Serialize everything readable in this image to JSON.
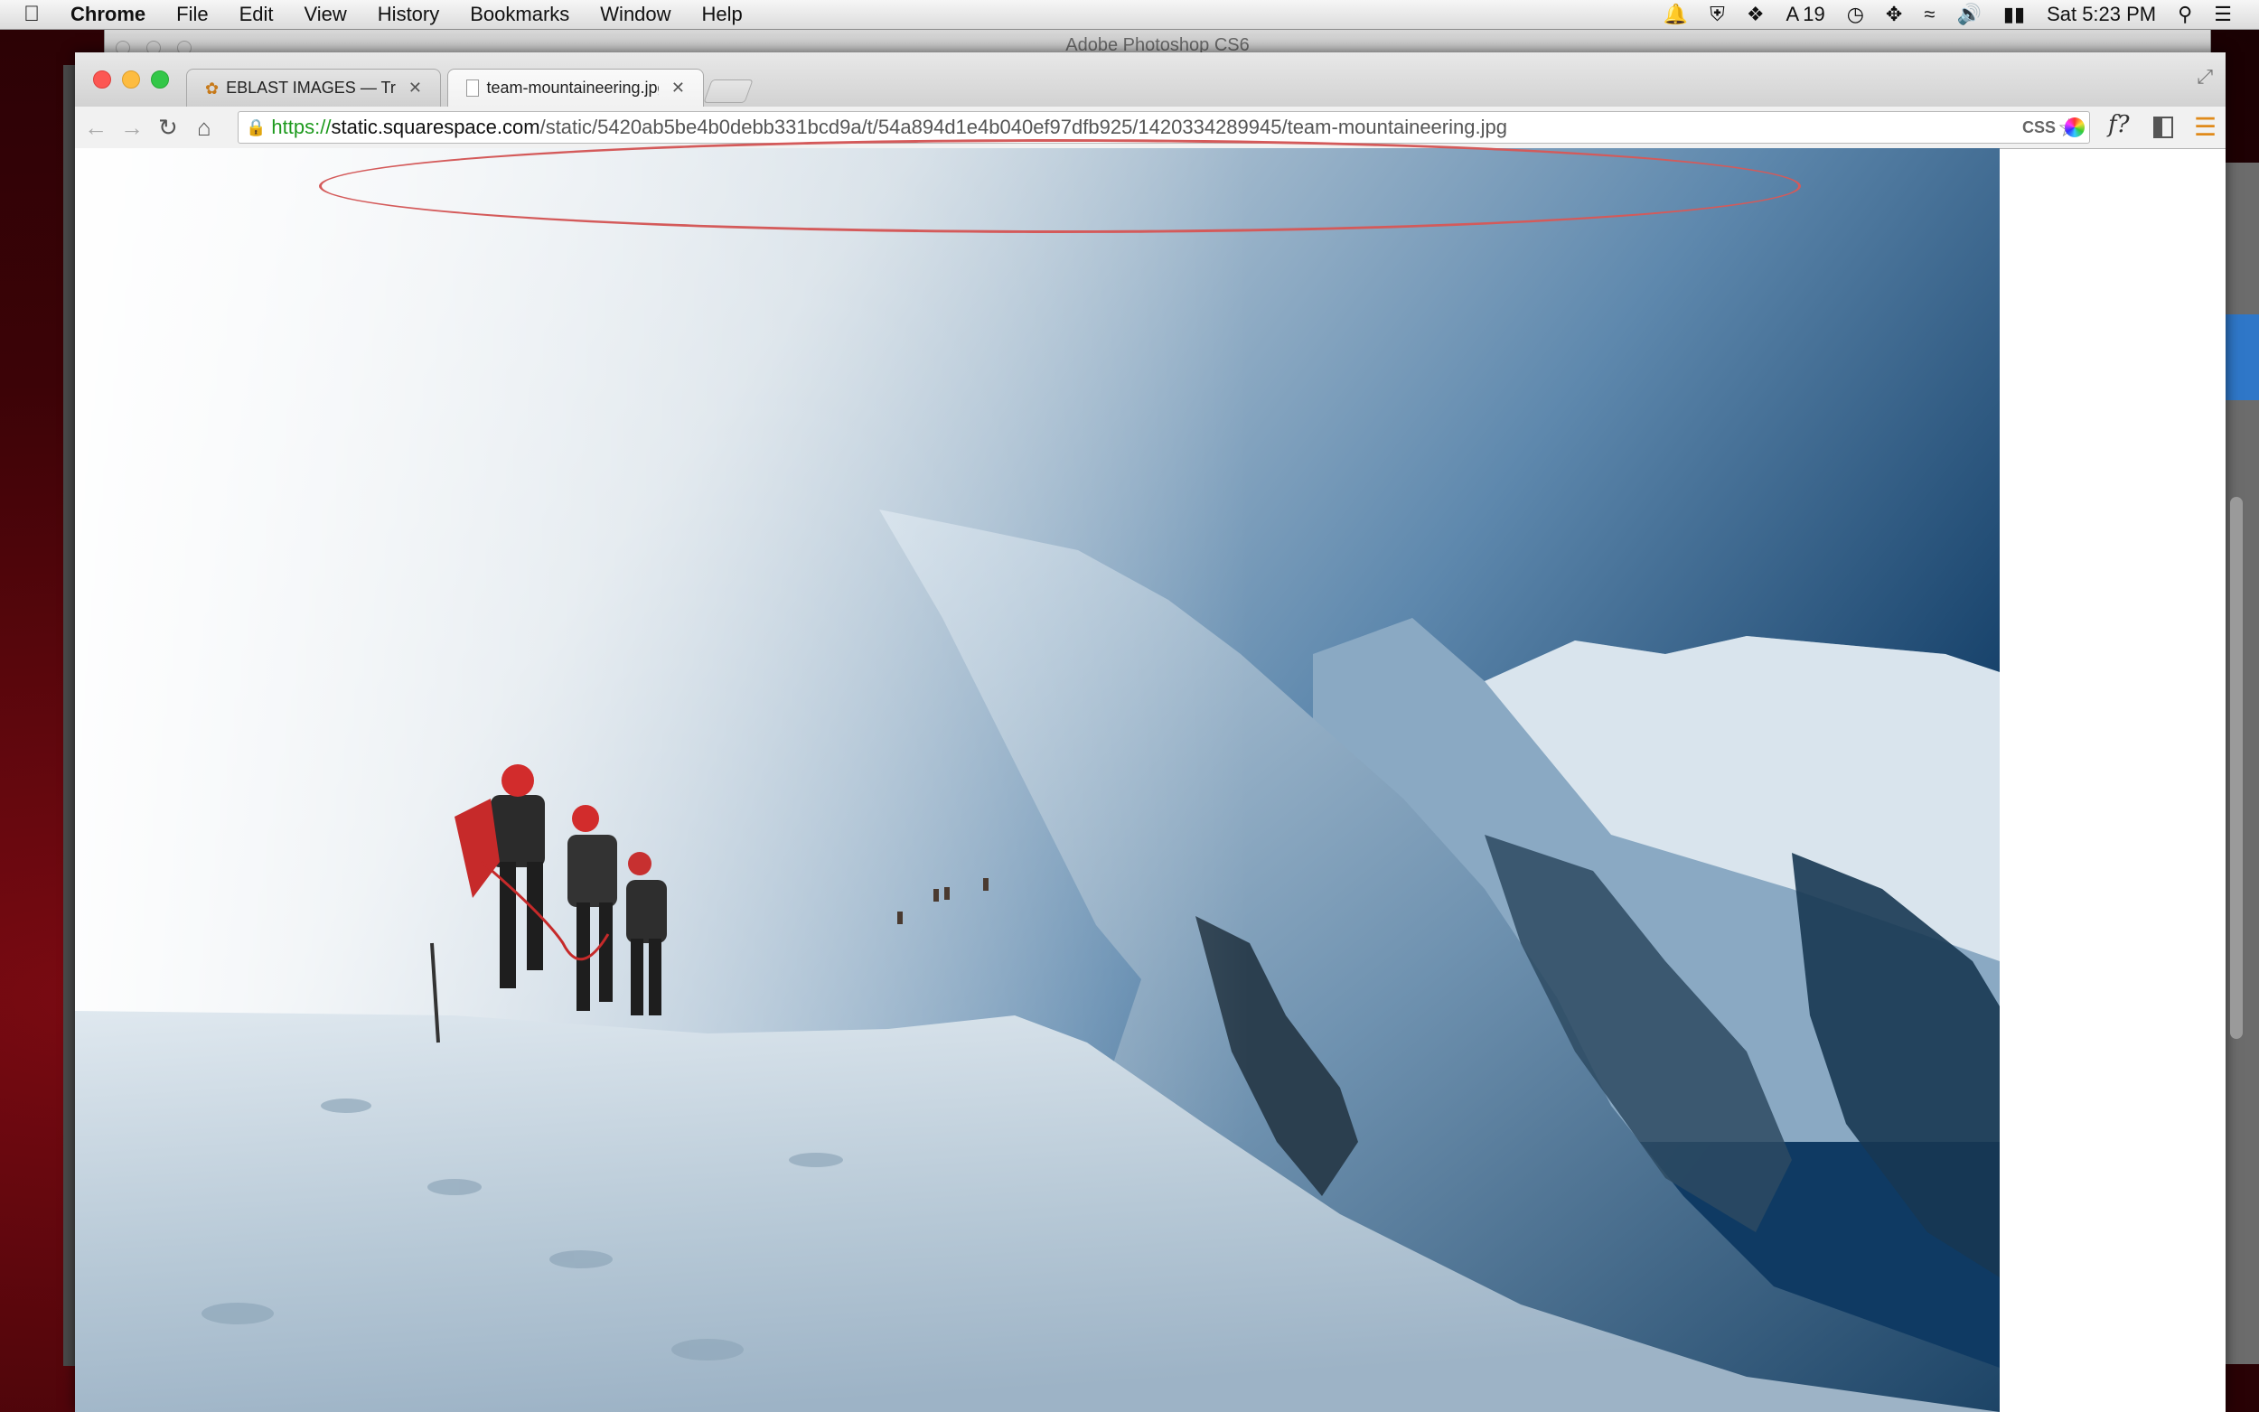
{
  "menubar": {
    "app_name": "Chrome",
    "menus": [
      "File",
      "Edit",
      "View",
      "History",
      "Bookmarks",
      "Window",
      "Help"
    ],
    "status": {
      "badge_count": "19",
      "clock": "Sat 5:23 PM"
    }
  },
  "background_window": {
    "title": "Adobe Photoshop CS6"
  },
  "browser": {
    "tabs": [
      {
        "label": "EBLAST IMAGES — Triton P",
        "active": false
      },
      {
        "label": "team-mountaineering.jpg",
        "active": true
      }
    ],
    "address": {
      "scheme": "https://",
      "host": "static.squarespace.com",
      "path": "/static/5420ab5be4b0debb331bcd9a/t/54a894d1e4b040ef97dfb925/1420334289945/team-mountaineering.jpg"
    },
    "extensions": {
      "css_label": "CSS",
      "font_label": "f?"
    }
  },
  "content": {
    "image_description": "team-mountaineering photo"
  },
  "colors": {
    "annotation": "#d45a5a",
    "scheme_green": "#1e9a1e"
  }
}
